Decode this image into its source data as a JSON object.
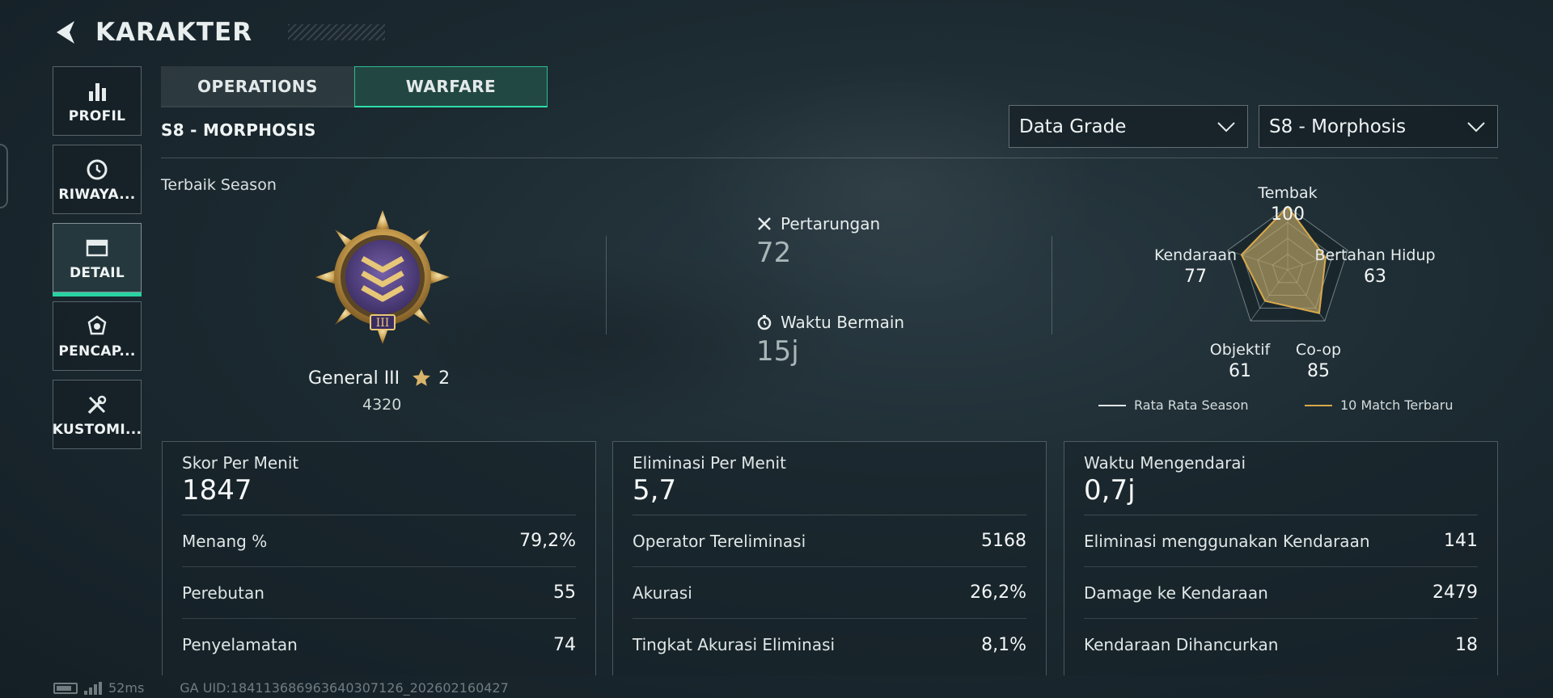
{
  "header": {
    "title": "KARAKTER"
  },
  "sidebar": {
    "items": [
      {
        "label": "PROFIL",
        "icon": "bar-chart-icon"
      },
      {
        "label": "RIWAYA...",
        "icon": "history-icon"
      },
      {
        "label": "DETAIL",
        "icon": "folder-icon",
        "active": true
      },
      {
        "label": "PENCAP...",
        "icon": "achievement-icon"
      },
      {
        "label": "KUSTOMI...",
        "icon": "tools-icon"
      }
    ]
  },
  "tabs": [
    {
      "label": "OPERATIONS",
      "active": false
    },
    {
      "label": "WARFARE",
      "active": true
    }
  ],
  "season": {
    "title": "S8 - MORPHOSIS"
  },
  "filters": {
    "grade": {
      "value": "Data Grade"
    },
    "season": {
      "value": "S8 - Morphosis"
    }
  },
  "best_season": {
    "label": "Terbaik Season",
    "rank_name": "General III",
    "stars": "2",
    "points": "4320"
  },
  "summary": {
    "battles": {
      "label": "Pertarungan",
      "value": "72"
    },
    "playtime": {
      "label": "Waktu Bermain",
      "value": "15j"
    }
  },
  "radar": {
    "axes": [
      {
        "label": "Tembak",
        "value": "100"
      },
      {
        "label": "Bertahan Hidup",
        "value": "63"
      },
      {
        "label": "Co-op",
        "value": "85"
      },
      {
        "label": "Objektif",
        "value": "61"
      },
      {
        "label": "Kendaraan",
        "value": "77"
      }
    ],
    "legend": {
      "season_avg": "Rata Rata Season",
      "recent": "10 Match Terbaru"
    },
    "colors": {
      "season_avg": "#dfe6e6",
      "recent": "#d8a84a"
    }
  },
  "cards": [
    {
      "title": "Skor Per Menit",
      "value": "1847",
      "rows": [
        {
          "label": "Menang %",
          "value": "79,2%"
        },
        {
          "label": "Perebutan",
          "value": "55"
        },
        {
          "label": "Penyelamatan",
          "value": "74"
        }
      ]
    },
    {
      "title": "Eliminasi Per Menit",
      "value": "5,7",
      "rows": [
        {
          "label": "Operator Tereliminasi",
          "value": "5168"
        },
        {
          "label": "Akurasi",
          "value": "26,2%"
        },
        {
          "label": "Tingkat Akurasi Eliminasi",
          "value": "8,1%"
        }
      ]
    },
    {
      "title": "Waktu Mengendarai",
      "value": "0,7j",
      "rows": [
        {
          "label": "Eliminasi menggunakan Kendaraan",
          "value": "141"
        },
        {
          "label": "Damage ke Kendaraan",
          "value": "2479"
        },
        {
          "label": "Kendaraan Dihancurkan",
          "value": "18"
        }
      ]
    }
  ],
  "footer": {
    "ping": "52ms",
    "uid": "GA UID:184113686963640307126_202602160427"
  },
  "accent_color": "#27d3a0"
}
